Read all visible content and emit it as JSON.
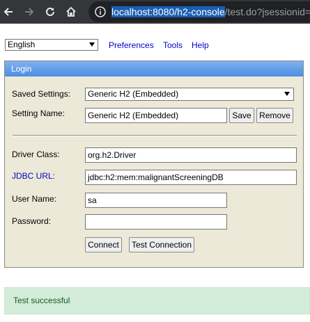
{
  "browser": {
    "url_selected": "localhost:8080/h2-console",
    "url_rest": "/test.do?jsessionid="
  },
  "toolbar": {
    "language": "English",
    "links": {
      "preferences": "Preferences",
      "tools": "Tools",
      "help": "Help"
    }
  },
  "login": {
    "header": "Login",
    "saved_settings_label": "Saved Settings:",
    "saved_settings_value": "Generic H2 (Embedded)",
    "setting_name_label": "Setting Name:",
    "setting_name_value": "Generic H2 (Embedded)",
    "save_button": "Save",
    "remove_button": "Remove",
    "driver_class_label": "Driver Class:",
    "driver_class_value": "org.h2.Driver",
    "jdbc_url_label": "JDBC URL:",
    "jdbc_url_value": "jdbc:h2:mem:malignantScreeningDB",
    "user_name_label": "User Name:",
    "user_name_value": "sa",
    "password_label": "Password:",
    "password_value": "",
    "connect_button": "Connect",
    "test_connection_button": "Test Connection"
  },
  "status": {
    "message": "Test successful"
  },
  "colors": {
    "header_blue": "#4d8de2",
    "panel_bg": "#ece9d8",
    "link_blue": "#0000cc",
    "success_bg": "#d4edda",
    "success_text": "#155724"
  }
}
